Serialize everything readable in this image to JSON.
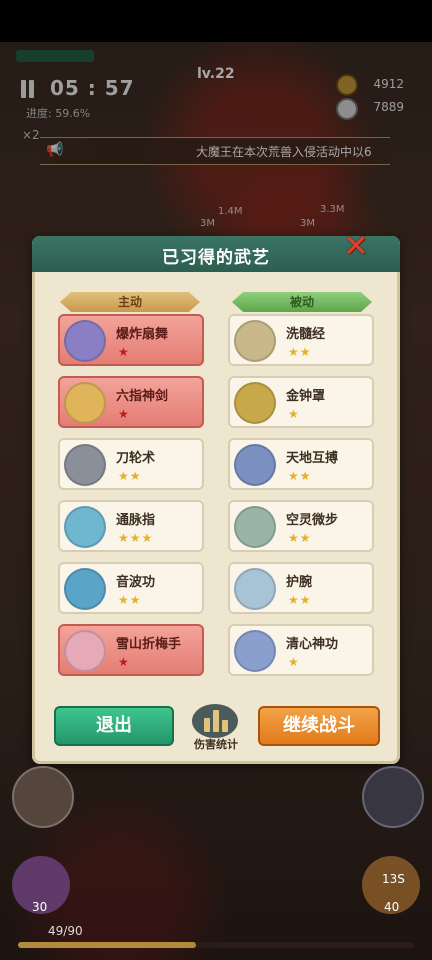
{
  "hud": {
    "timer": "05 : 57",
    "level": "lv.22",
    "progress_label": "进度: 59.6%",
    "gold": "4912",
    "kills": "7889",
    "multiplier": "×2"
  },
  "marquee": {
    "text": "大魔王在本次荒兽入侵活动中以6"
  },
  "floating_damage": [
    "1.4M",
    "3M",
    "3.3M",
    "3M"
  ],
  "panel": {
    "title": "已习得的武艺",
    "close_icon": "close-x-icon",
    "active_label": "主动",
    "passive_label": "被动",
    "active_skills": [
      {
        "name": "爆炸扇舞",
        "stars": "★",
        "icon": "fan-icon",
        "highlight": true,
        "icon_color": "#8a7fc4"
      },
      {
        "name": "六指神剑",
        "stars": "★",
        "icon": "crystal-sword-icon",
        "highlight": true,
        "icon_color": "#e0b45a"
      },
      {
        "name": "刀轮术",
        "stars": "★★",
        "icon": "blade-wheel-icon",
        "highlight": false,
        "icon_color": "#8a8f99"
      },
      {
        "name": "通脉指",
        "stars": "★★★",
        "icon": "finger-strike-icon",
        "highlight": false,
        "icon_color": "#6fb6cf"
      },
      {
        "name": "音波功",
        "stars": "★★",
        "icon": "sound-wave-icon",
        "highlight": false,
        "icon_color": "#5aa4c8"
      },
      {
        "name": "雪山折梅手",
        "stars": "★",
        "icon": "plum-blossom-icon",
        "highlight": true,
        "icon_color": "#e6a9b8"
      }
    ],
    "passive_skills": [
      {
        "name": "洗髓经",
        "stars": "★★",
        "icon": "monk-icon",
        "icon_color": "#c9b88a"
      },
      {
        "name": "金钟罩",
        "stars": "★",
        "icon": "golden-bell-icon",
        "icon_color": "#c7a94a"
      },
      {
        "name": "天地互搏",
        "stars": "★★",
        "icon": "dual-fighters-icon",
        "icon_color": "#7b8fc0"
      },
      {
        "name": "空灵微步",
        "stars": "★★",
        "icon": "light-step-icon",
        "icon_color": "#9ab5a8"
      },
      {
        "name": "护腕",
        "stars": "★★",
        "icon": "wrist-guard-icon",
        "icon_color": "#a9c3d6"
      },
      {
        "name": "清心神功",
        "stars": "★",
        "icon": "meditation-icon",
        "icon_color": "#8a9fce"
      }
    ]
  },
  "buttons": {
    "exit": "退出",
    "stats": "伤害统计",
    "continue": "继续战斗"
  },
  "bottom": {
    "skill_left_count": "30",
    "skill_right_count": "40",
    "skill_right_cd": "13S",
    "hp": "49/90",
    "xp_fraction": 0.45
  }
}
